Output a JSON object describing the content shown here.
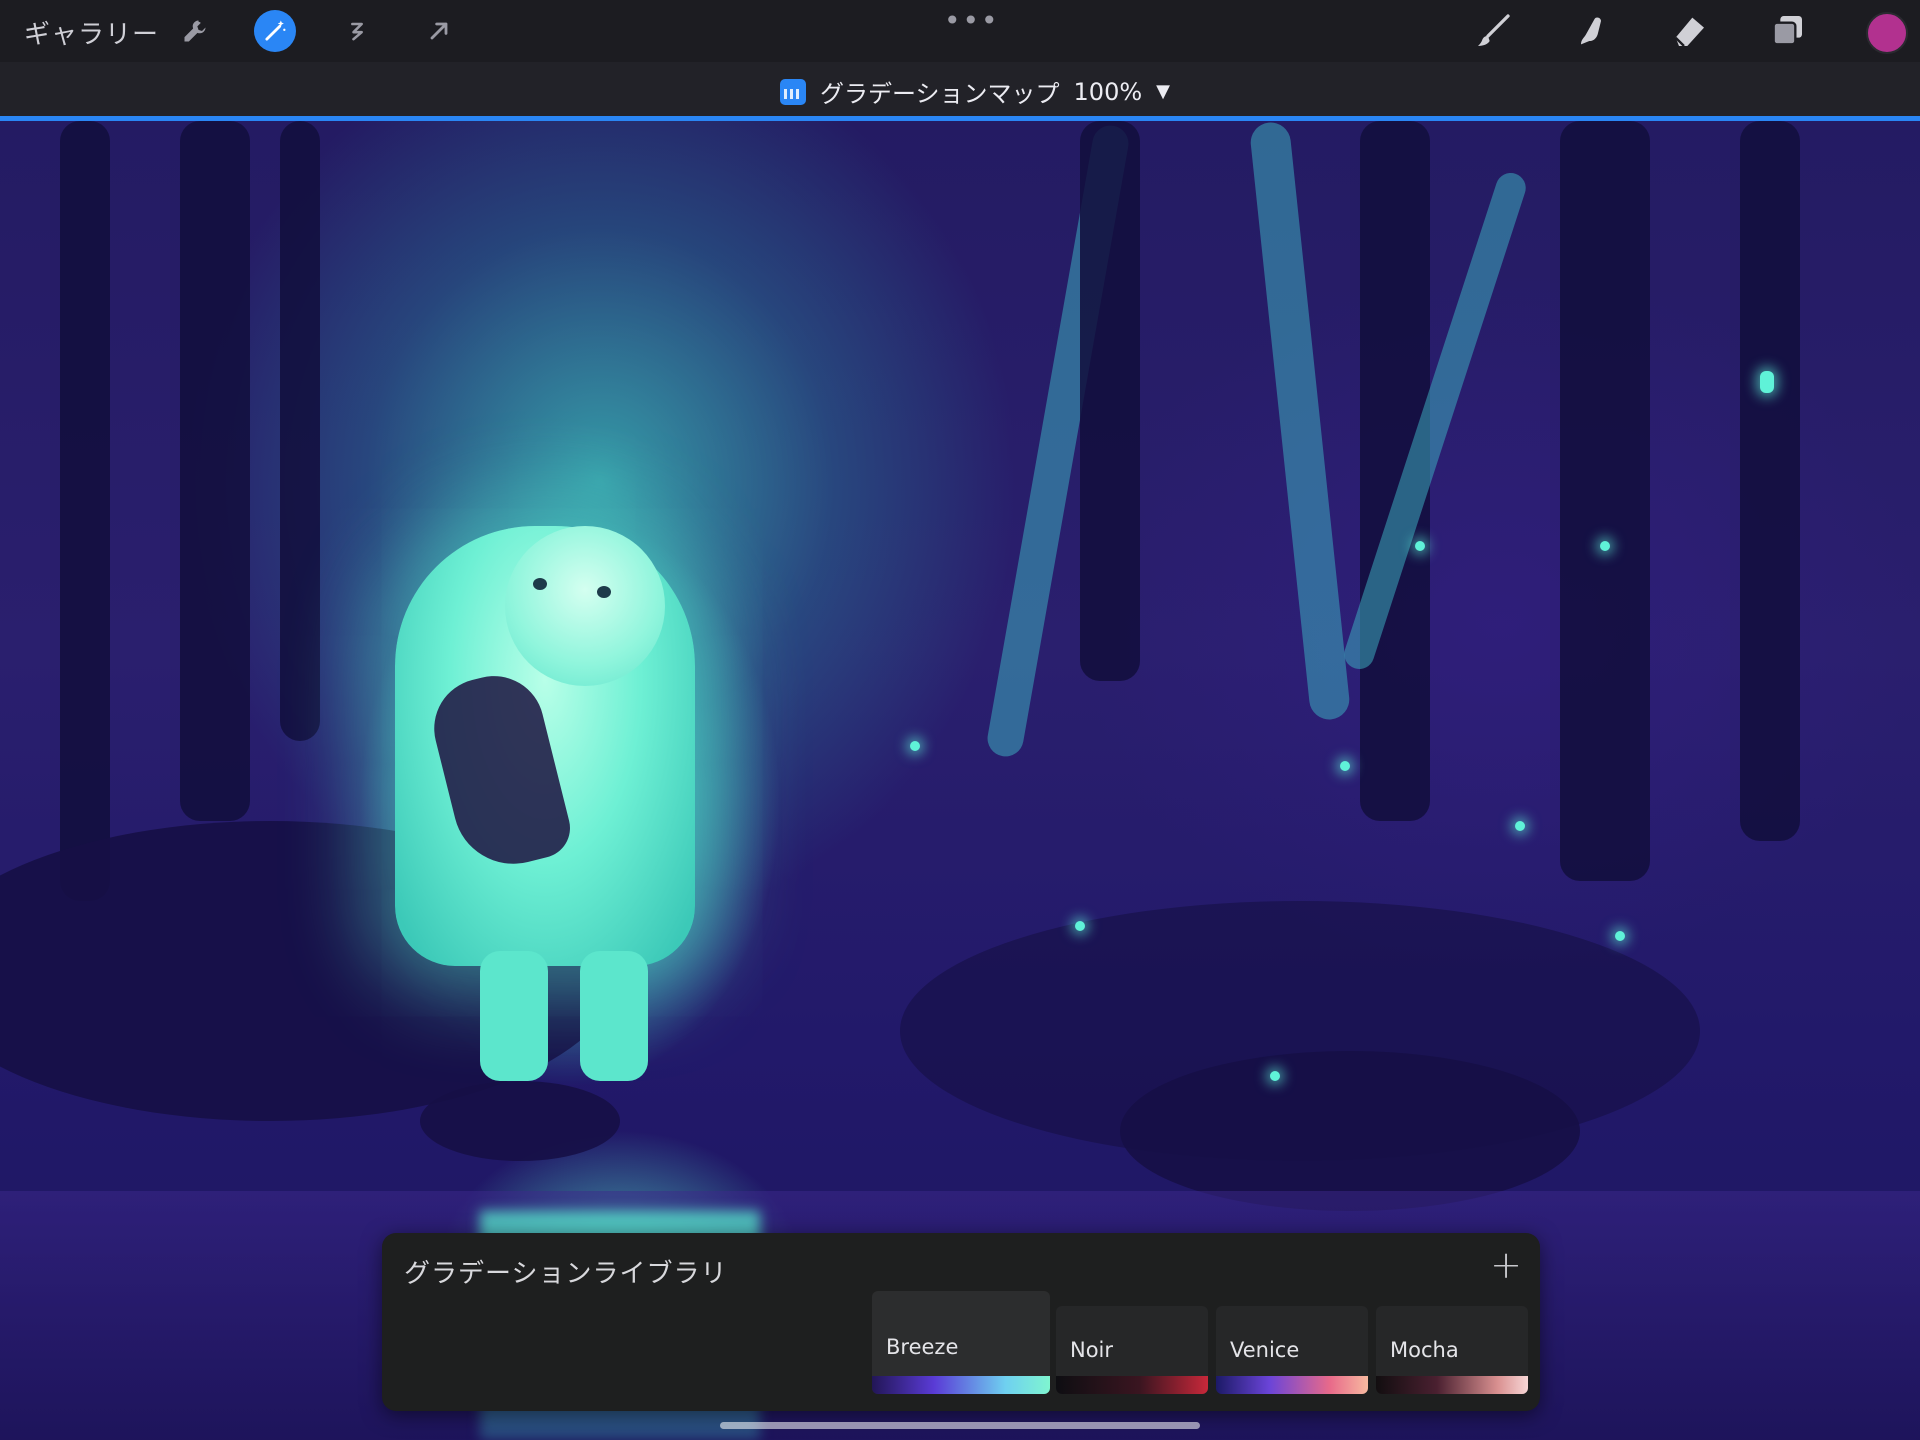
{
  "toolbar": {
    "gallery_label": "ギャラリー",
    "left_icons": [
      "wrench-icon",
      "magic-wand-icon",
      "selection-icon",
      "transform-arrow-icon"
    ],
    "right_icons": [
      "brush-icon",
      "smudge-icon",
      "eraser-icon",
      "layers-icon"
    ],
    "current_color": "#b2318f",
    "accent_color": "#2a86f5",
    "more_dots": "•••"
  },
  "adjustment": {
    "name": "グラデーションマップ",
    "percent": "100%",
    "caret": "▼"
  },
  "gradient_library": {
    "title": "グラデーションライブラリ",
    "add_label": "+",
    "gradients": [
      {
        "name": "Breeze",
        "selected": true,
        "stops": [
          "#221656",
          "#5a3bd6",
          "#6fd0f0",
          "#7ff5d0"
        ]
      },
      {
        "name": "Noir",
        "selected": false,
        "stops": [
          "#0e0e12",
          "#3a1520",
          "#c8283a"
        ]
      },
      {
        "name": "Venice",
        "selected": false,
        "stops": [
          "#1c1a66",
          "#6a44d8",
          "#e86a8a",
          "#f7b9a0"
        ]
      },
      {
        "name": "Mocha",
        "selected": false,
        "stops": [
          "#120e10",
          "#4a2030",
          "#d99090",
          "#f7d6d6"
        ]
      }
    ]
  }
}
